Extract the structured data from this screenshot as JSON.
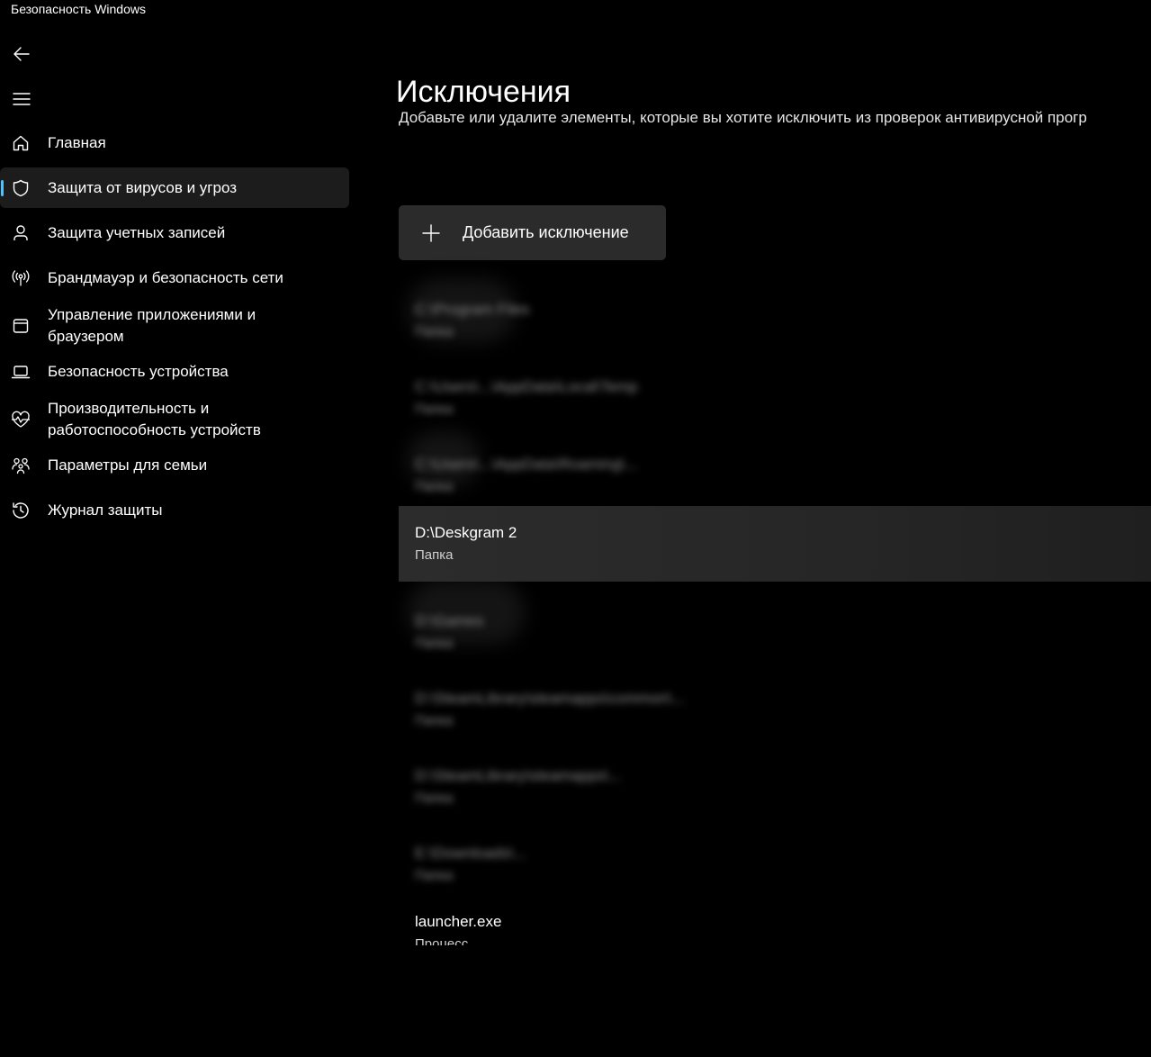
{
  "window": {
    "title": "Безопасность Windows"
  },
  "nav": {
    "back_icon": "back-arrow-icon",
    "menu_icon": "hamburger-menu-icon",
    "items": [
      {
        "label": "Главная",
        "icon": "home-icon",
        "active": false
      },
      {
        "label": "Защита от вирусов и угроз",
        "icon": "shield-icon",
        "active": true
      },
      {
        "label": "Защита учетных записей",
        "icon": "person-icon",
        "active": false
      },
      {
        "label": "Брандмауэр и безопасность сети",
        "icon": "antenna-icon",
        "active": false
      },
      {
        "label": "Управление приложениями и браузером",
        "icon": "app-window-icon",
        "active": false
      },
      {
        "label": "Безопасность устройства",
        "icon": "laptop-icon",
        "active": false
      },
      {
        "label": "Производительность и работоспособность устройств",
        "icon": "heart-pulse-icon",
        "active": false
      },
      {
        "label": "Параметры для семьи",
        "icon": "family-icon",
        "active": false
      },
      {
        "label": "Журнал защиты",
        "icon": "history-icon",
        "active": false
      }
    ]
  },
  "main": {
    "title": "Исключения",
    "description": "Добавьте или удалите элементы, которые вы хотите исключить из проверок антивирусной прогр",
    "add_button_label": "Добавить исключение",
    "exclusions": [
      {
        "name": "C:\\Program Files",
        "type": "Папка",
        "blurred": true
      },
      {
        "name": "C:\\Users\\...\\AppData\\Local\\Temp",
        "type": "Папка",
        "blurred": true
      },
      {
        "name": "C:\\Users\\...\\AppData\\Roaming\\...",
        "type": "Папка",
        "blurred": true
      },
      {
        "name": "D:\\Deskgram 2",
        "type": "Папка",
        "blurred": false,
        "selected": true
      },
      {
        "name": "D:\\Games",
        "type": "Папка",
        "blurred": true
      },
      {
        "name": "D:\\SteamLibrary\\steamapps\\common\\...",
        "type": "Папка",
        "blurred": true
      },
      {
        "name": "D:\\SteamLibrary\\steamapps\\...",
        "type": "Папка",
        "blurred": true
      },
      {
        "name": "E:\\Downloads\\...",
        "type": "Папка",
        "blurred": true
      },
      {
        "name": "launcher.exe",
        "type": "Процесс",
        "blurred": false
      }
    ]
  },
  "colors": {
    "background": "#000000",
    "nav_active_bg": "#1c1c1c",
    "accent_indicator": "#4cc2ff",
    "button_bg": "#2b2b2b",
    "selected_row_bg": "#2c2c2c"
  }
}
